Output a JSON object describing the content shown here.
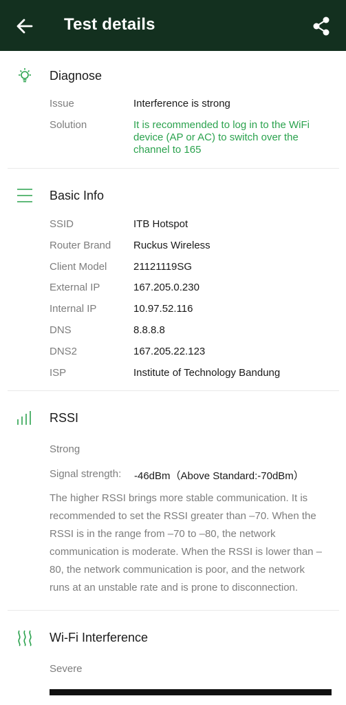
{
  "appbar": {
    "title": "Test details"
  },
  "diagnose": {
    "title": "Diagnose",
    "issue_label": "Issue",
    "issue_value": "Interference is strong",
    "solution_label": "Solution",
    "solution_value": "It is recommended to log in to the WiFi device (AP or AC) to switch over the channel to 165"
  },
  "basic_info": {
    "title": "Basic Info",
    "rows": [
      {
        "label": "SSID",
        "value": "ITB Hotspot"
      },
      {
        "label": "Router Brand",
        "value": "Ruckus Wireless"
      },
      {
        "label": "Client Model",
        "value": "21121119SG"
      },
      {
        "label": "External IP",
        "value": "167.205.0.230"
      },
      {
        "label": "Internal IP",
        "value": "10.97.52.116"
      },
      {
        "label": "DNS",
        "value": "8.8.8.8"
      },
      {
        "label": "DNS2",
        "value": "167.205.22.123"
      },
      {
        "label": "ISP",
        "value": "Institute of Technology Bandung"
      }
    ]
  },
  "rssi": {
    "title": "RSSI",
    "status": "Strong",
    "signal_label": "Signal strength:",
    "signal_value": "-46dBm（Above Standard:-70dBm）",
    "description": "The higher RSSI brings more stable communication. It is recommended to set the RSSI greater than –70. When the RSSI is in the range from –70 to –80, the network communication is moderate. When the RSSI is lower than –80, the network communication is poor, and the network runs at an unstable rate and is prone to disconnection."
  },
  "interference": {
    "title": "Wi-Fi Interference",
    "status": "Severe"
  },
  "colors": {
    "appbar": "#13301f",
    "accent": "#2aa24d",
    "muted": "#7d7d7d"
  }
}
